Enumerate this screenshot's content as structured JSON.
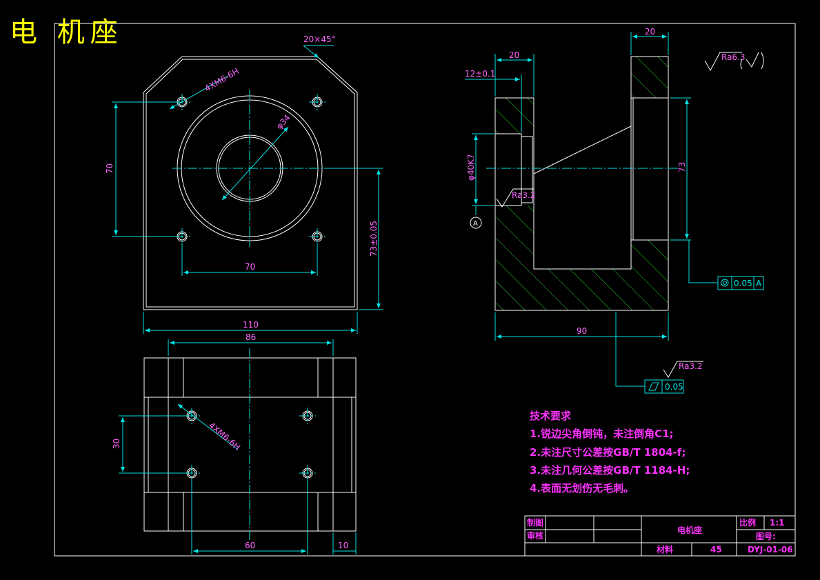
{
  "title": "电 机座",
  "dims": {
    "chamfer": "20×45°",
    "tap_top": "4XM6-6H",
    "dia34": "φ34",
    "v70": "70",
    "h70": "70",
    "v73": "73±0.05",
    "w110": "110",
    "w86": "86",
    "tap_bottom": "4XM6-6H",
    "v30": "30",
    "w60": "60",
    "w10": "10",
    "s20a": "20",
    "s20b": "20",
    "s12": "12±0.1",
    "bore": "φ40K7",
    "ra32a": "Ra3.2",
    "datum": "A",
    "s73": "73",
    "s90": "90",
    "ra63": "Ra6.3",
    "coax_val": "0.05",
    "coax_ref": "A",
    "ra32b": "Ra3.2",
    "flat_val": "0.05"
  },
  "tech": {
    "heading": "技术要求",
    "items": [
      "1.锐边尖角倒钝，未注倒角C1;",
      "2.未注尺寸公差按GB/T 1804-f;",
      "3.未注几何公差按GB/T 1184-H;",
      "4.表面无划伤无毛刺。"
    ]
  },
  "titleblock": {
    "draw": "制图",
    "check": "审核",
    "part": "电机座",
    "scale_label": "比例",
    "scale": "1:1",
    "dwg_label": "图号:",
    "dwg_no": "DYJ-01-06",
    "material_label": "材料",
    "material": "45"
  },
  "colors": {
    "background": "#000000",
    "outline": "#ffffff",
    "dimension": "#00e5e5",
    "text": "#ff33ff",
    "hatch": "#33cc33",
    "title": "#ffff00"
  }
}
